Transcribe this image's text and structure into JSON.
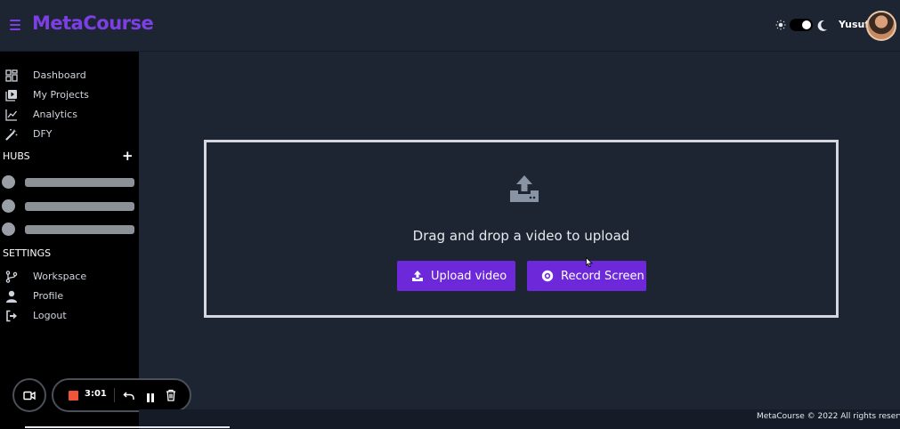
{
  "header": {
    "logo": "MetaCourse",
    "username": "Yusuf"
  },
  "sidebar": {
    "items": [
      {
        "label": "Dashboard",
        "icon": "dashboard-icon"
      },
      {
        "label": "My Projects",
        "icon": "projects-icon"
      },
      {
        "label": "Analytics",
        "icon": "analytics-icon"
      },
      {
        "label": "DFY",
        "icon": "magic-wand-icon"
      }
    ],
    "hubs_title": "HUBS",
    "settings_title": "SETTINGS",
    "settings_items": [
      {
        "label": "Workspace",
        "icon": "workspace-icon"
      },
      {
        "label": "Profile",
        "icon": "user-icon"
      },
      {
        "label": "Logout",
        "icon": "logout-icon"
      }
    ]
  },
  "dropzone": {
    "text": "Drag and drop a video to upload",
    "upload_button": "Upload video",
    "record_button": "Record Screen"
  },
  "recorder": {
    "time": "3:01"
  },
  "footer": {
    "text": "MetaCourse © 2022 All rights reserved"
  },
  "colors": {
    "accent": "#6d28d9",
    "logo": "#7b3fe4",
    "background": "#1d2532",
    "sidebar": "#000000",
    "record_stop": "#f0553a"
  }
}
